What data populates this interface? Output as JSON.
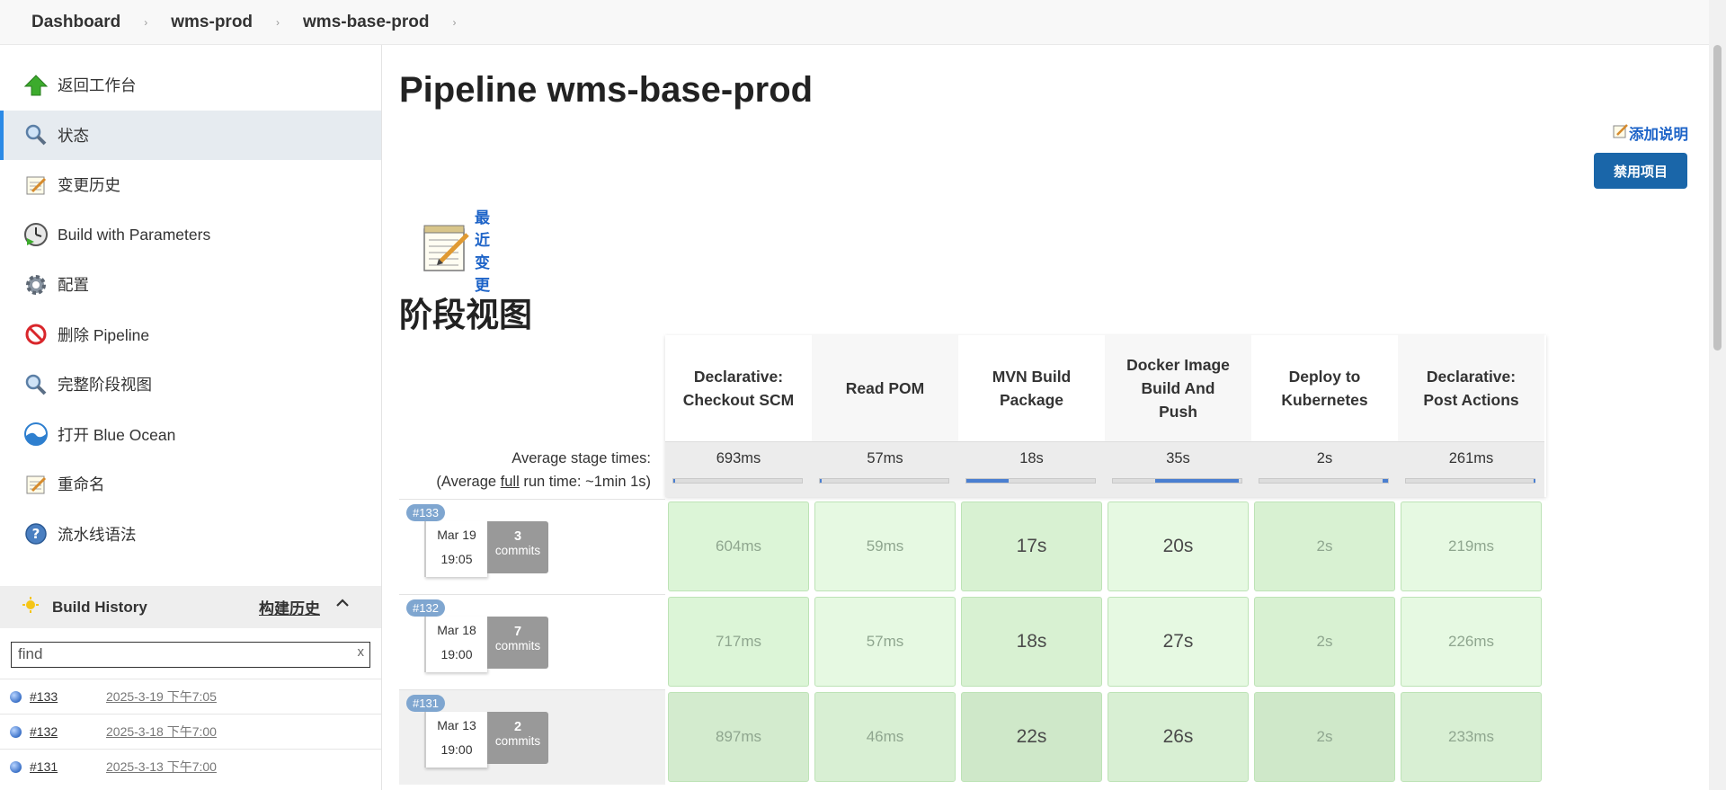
{
  "breadcrumb": [
    "Dashboard",
    "wms-prod",
    "wms-base-prod"
  ],
  "sidebar": {
    "items": [
      {
        "label": "返回工作台",
        "icon": "up-arrow-icon"
      },
      {
        "label": "状态",
        "icon": "magnifier-icon"
      },
      {
        "label": "变更历史",
        "icon": "notepad-icon"
      },
      {
        "label": "Build with Parameters",
        "icon": "clock-icon"
      },
      {
        "label": "配置",
        "icon": "gear-icon"
      },
      {
        "label": "删除 Pipeline",
        "icon": "no-entry-icon"
      },
      {
        "label": "完整阶段视图",
        "icon": "magnifier-icon"
      },
      {
        "label": "打开 Blue Ocean",
        "icon": "blue-ocean-icon"
      },
      {
        "label": "重命名",
        "icon": "notepad-icon"
      },
      {
        "label": "流水线语法",
        "icon": "help-icon"
      }
    ]
  },
  "build_history": {
    "title": "Build History",
    "title_cn": "构建历史",
    "find_placeholder": "find",
    "clear": "x",
    "builds": [
      {
        "num": "#133",
        "date": "2025-3-19 下午7:05"
      },
      {
        "num": "#132",
        "date": "2025-3-18 下午7:00"
      },
      {
        "num": "#131",
        "date": "2025-3-13 下午7:00"
      }
    ]
  },
  "main": {
    "title": "Pipeline wms-base-prod",
    "add_description": "添加说明",
    "disable_button": "禁用项目",
    "recent_changes": "最近变更",
    "stage_view_title": "阶段视图",
    "avg_stage_label": "Average stage times:",
    "avg_run_prefix": "(Average ",
    "avg_run_full": "full",
    "avg_run_suffix": " run time: ~1min 1s)"
  },
  "stages": [
    {
      "name_l1": "Declarative:",
      "name_l2": "Checkout SCM",
      "name_l3": "",
      "avg": "693ms",
      "bar_start": 0.0,
      "bar_width": 0.01
    },
    {
      "name_l1": "Read POM",
      "name_l2": "",
      "name_l3": "",
      "avg": "57ms",
      "bar_start": 0.0,
      "bar_width": 0.01
    },
    {
      "name_l1": "MVN Build",
      "name_l2": "Package",
      "name_l3": "",
      "avg": "18s",
      "bar_start": 0.0,
      "bar_width": 0.33
    },
    {
      "name_l1": "Docker Image",
      "name_l2": "Build And",
      "name_l3": "Push",
      "avg": "35s",
      "bar_start": 0.33,
      "bar_width": 0.65
    },
    {
      "name_l1": "Deploy to",
      "name_l2": "Kubernetes",
      "name_l3": "",
      "avg": "2s",
      "bar_start": 0.96,
      "bar_width": 0.04
    },
    {
      "name_l1": "Declarative:",
      "name_l2": "Post Actions",
      "name_l3": "",
      "avg": "261ms",
      "bar_start": 0.99,
      "bar_width": 0.01
    }
  ],
  "runs": [
    {
      "badge": "#133",
      "date": "Mar 19",
      "time": "19:05",
      "commits_n": "3",
      "commits_label": "commits",
      "cells": [
        "604ms",
        "59ms",
        "17s",
        "20s",
        "2s",
        "219ms"
      ]
    },
    {
      "badge": "#132",
      "date": "Mar 18",
      "time": "19:00",
      "commits_n": "7",
      "commits_label": "commits",
      "cells": [
        "717ms",
        "57ms",
        "18s",
        "27s",
        "2s",
        "226ms"
      ]
    },
    {
      "badge": "#131",
      "date": "Mar 13",
      "time": "19:00",
      "commits_n": "2",
      "commits_label": "commits",
      "cells": [
        "897ms",
        "46ms",
        "22s",
        "26s",
        "2s",
        "233ms"
      ]
    }
  ],
  "colors": {
    "accent": "#1a66a9",
    "success_cell": "#e2f7de",
    "link": "#1e64c8"
  }
}
